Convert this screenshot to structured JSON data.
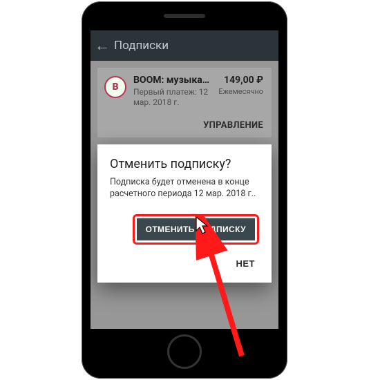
{
  "header": {
    "title": "Подписки"
  },
  "subscription": {
    "icon_letter": "B",
    "title": "BOOM: музыкальный...",
    "next_charge_line1": "Первый платеж: 12",
    "next_charge_line2": "мар. 2018 г.",
    "price": "149,00 ₽",
    "period": "Ежемесячно",
    "manage_label": "УПРАВЛЕНИЕ"
  },
  "dialog": {
    "title": "Отменить подписку?",
    "body_line1": "Подписка будет отменена в конце",
    "body_line2": "расчетного периода 12 мар. 2018 г..",
    "confirm_label": "ОТМЕНИТЬ ПОДПИСКУ",
    "cancel_label": "НЕТ"
  }
}
